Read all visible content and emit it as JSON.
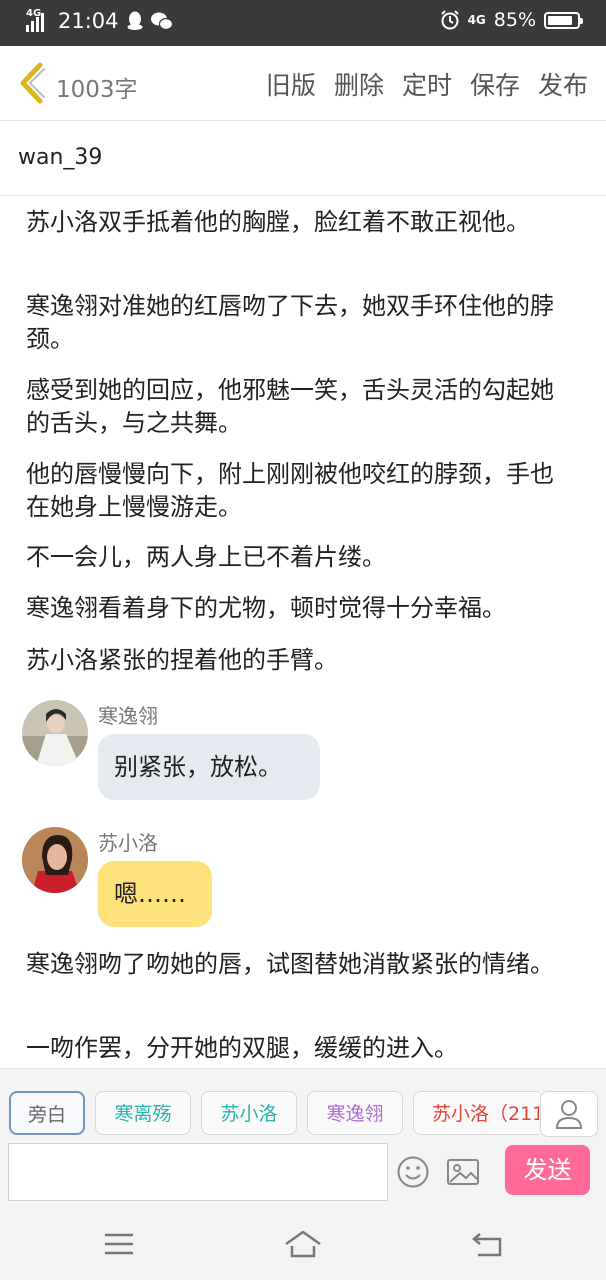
{
  "status_bar": {
    "network": "4G",
    "time": "21:04",
    "network2": "4G",
    "battery": "85%",
    "battery_level": 0.85
  },
  "header": {
    "word_count": "1003字",
    "actions": [
      "旧版",
      "删除",
      "定时",
      "保存",
      "发布"
    ]
  },
  "author": "wan_39",
  "content": {
    "paragraphs_top": [
      "苏小洛双手抵着他的胸膛，脸红着不敢正视他。",
      "寒逸翎对准她的红唇吻了下去，她双手环住他的脖颈。",
      "感受到她的回应，他邪魅一笑，舌头灵活的勾起她的舌头，与之共舞。",
      "他的唇慢慢向下，附上刚刚被他咬红的脖颈，手也在她身上慢慢游走。",
      "不一会儿，两人身上已不着片缕。",
      "寒逸翎看着身下的尤物，顿时觉得十分幸福。",
      "苏小洛紧张的捏着他的手臂。"
    ],
    "dialogues": [
      {
        "name": "寒逸翎",
        "text": "别紧张，放松。",
        "color": "#e5eaf1"
      },
      {
        "name": "苏小洛",
        "text": "嗯……",
        "color": "#fde17a"
      }
    ],
    "paragraphs_bottom": [
      "寒逸翎吻了吻她的唇，试图替她消散紧张的情绪。",
      "一吻作罢，分开她的双腿，缓缓的进入。"
    ]
  },
  "roles": [
    {
      "label": "旁白",
      "color": "#666666"
    },
    {
      "label": "寒离殇",
      "color": "#2bb3b0"
    },
    {
      "label": "苏小洛",
      "color": "#2bb3b0"
    },
    {
      "label": "寒逸翎",
      "color": "#b06bd6"
    },
    {
      "label": "苏小洛（211",
      "color": "#e0453a"
    }
  ],
  "input": {
    "placeholder": ""
  },
  "send_label": "发送",
  "icons": [
    "back-chevron-icon",
    "user-icon",
    "emoji-icon",
    "image-icon",
    "menu-icon",
    "home-icon",
    "return-icon"
  ]
}
